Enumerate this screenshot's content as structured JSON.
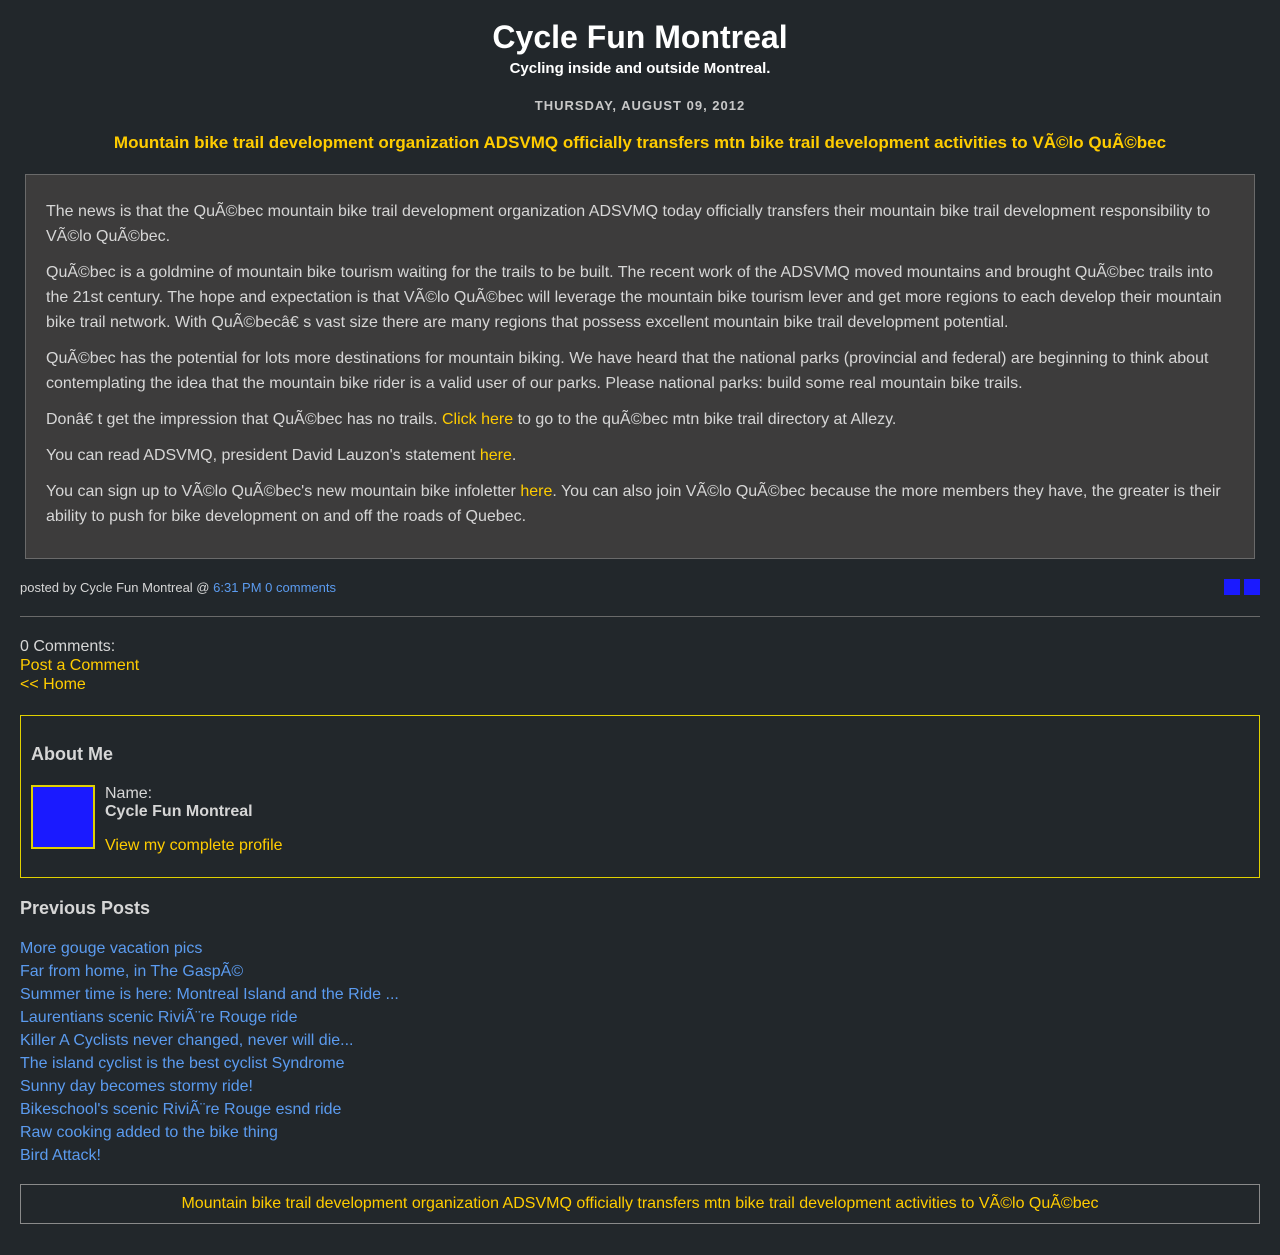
{
  "header": {
    "title": "Cycle Fun Montreal",
    "description": "Cycling inside and outside Montreal."
  },
  "post": {
    "date": "THURSDAY, AUGUST 09, 2012",
    "title": "Mountain bike trail development organization ADSVMQ officially transfers mtn bike trail development activities to VÃ©lo QuÃ©bec",
    "p1": "The news is that the QuÃ©bec mountain bike trail development organization ADSVMQ today officially transfers their mountain bike trail development responsibility to VÃ©lo QuÃ©bec.",
    "p2": "QuÃ©bec is a goldmine of mountain bike tourism waiting for the trails to be built. The recent work of the ADSVMQ moved mountains and brought QuÃ©bec trails into the 21st century. The hope and expectation is that VÃ©lo QuÃ©bec will leverage the mountain bike tourism lever and get more regions to each develop their mountain bike trail network. With QuÃ©becâ€   s vast size there are many regions that possess excellent mountain bike trail development potential.",
    "p3": "QuÃ©bec has the potential for lots more destinations for mountain biking. We have heard that the national parks (provincial and federal) are beginning to think about contemplating the idea that the mountain bike rider is a valid user of our parks. Please national parks: build some real mountain bike trails.",
    "p4_before": "Donâ€   t get the impression that QuÃ©bec has no trails. ",
    "p4_link": "Click here",
    "p4_after": " to go to the quÃ©bec mtn bike trail directory at Allezy.",
    "p5_before": "You can read ADSVMQ, president David Lauzon's statement ",
    "p5_link": "here",
    "p5_after": ".",
    "p6_before": "You can sign up to VÃ©lo QuÃ©bec's new mountain bike infoletter ",
    "p6_link": "here",
    "p6_after": ". You can also join VÃ©lo QuÃ©bec because the more members they have, the greater is their ability to push for bike development on and off the roads of Quebec.",
    "footer_prefix": "posted by Cycle Fun Montreal @ ",
    "time": "6:31 PM",
    "comments_link": "0 comments"
  },
  "comments": {
    "count_label": "0 Comments:",
    "post_comment": "Post a Comment",
    "home": "<< Home"
  },
  "about": {
    "heading": "About Me",
    "name_label": "Name:",
    "name": "Cycle Fun Montreal",
    "profile_link": "View my complete profile"
  },
  "previous": {
    "heading": "Previous Posts",
    "items": [
      "More gouge vacation pics",
      "Far from home, in The GaspÃ©",
      "Summer time is here: Montreal Island and the Ride ...",
      "Laurentians scenic RiviÃ¨re Rouge ride",
      "Killer A Cyclists never changed, never will die...",
      "The island cyclist is the best cyclist Syndrome",
      "Sunny day becomes stormy ride!",
      "Bikeschool's scenic RiviÃ¨re Rouge esnd ride",
      "Raw cooking added to the bike thing",
      "Bird Attack!"
    ]
  },
  "bottom_banner": "Mountain bike trail development organization ADSVMQ officially transfers mtn bike trail development activities to VÃ©lo QuÃ©bec"
}
